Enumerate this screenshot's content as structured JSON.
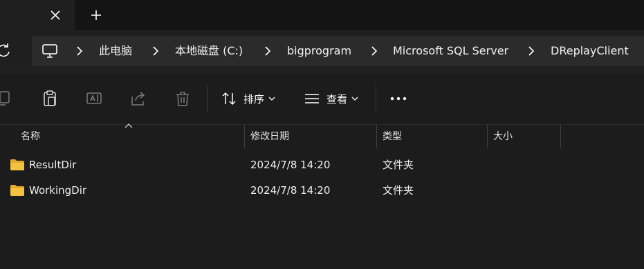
{
  "tabbar": {
    "close_icon": "close-icon",
    "new_tab_icon": "plus-icon"
  },
  "navbar": {
    "refresh_icon": "refresh-icon",
    "breadcrumb": [
      {
        "label": "此电脑",
        "icon": "computer-icon"
      },
      {
        "label": "本地磁盘 (C:)"
      },
      {
        "label": "bigprogram"
      },
      {
        "label": "Microsoft SQL Server"
      },
      {
        "label": "DReplayClient"
      }
    ]
  },
  "toolbar": {
    "icons": [
      "copy-icon",
      "paste-icon",
      "rename-icon",
      "share-icon",
      "delete-icon"
    ],
    "sort_label": "排序",
    "view_label": "查看",
    "more_icon": "more-icon"
  },
  "columns": {
    "name": "名称",
    "modified": "修改日期",
    "type": "类型",
    "size": "大小"
  },
  "rows": [
    {
      "name": "ResultDir",
      "modified": "2024/7/8 14:20",
      "type": "文件夹",
      "size": ""
    },
    {
      "name": "WorkingDir",
      "modified": "2024/7/8 14:20",
      "type": "文件夹",
      "size": ""
    }
  ],
  "colors": {
    "background": "#1c1c1c",
    "tabbar": "#141414",
    "address": "#2b2b2b",
    "folder": "#f4c242",
    "text": "#ffffff"
  }
}
